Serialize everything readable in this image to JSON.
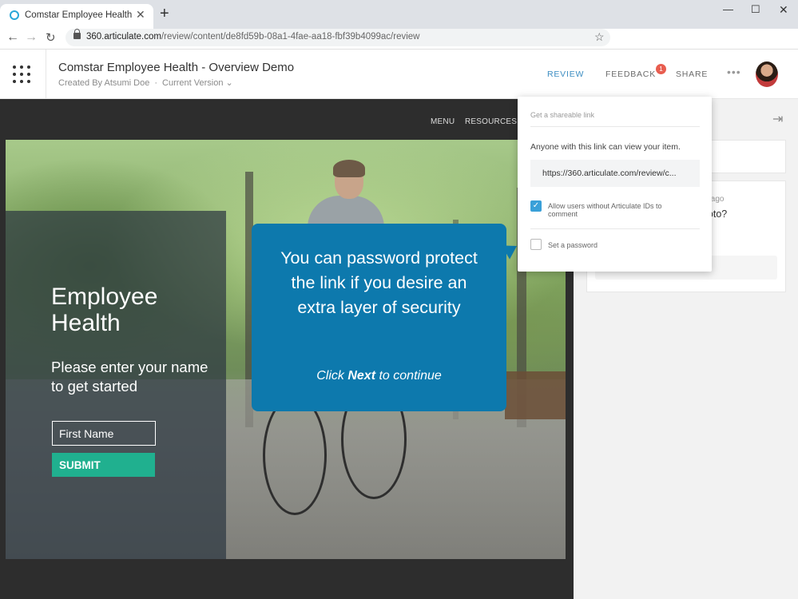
{
  "browser": {
    "tab_title": "Comstar Employee Health - Overview Demo",
    "new_tab_glyph": "+",
    "url_host": "360.articulate.com",
    "url_path": "/review/content/de8fd59b-08a1-4fae-aa18-fbf39b4099ac/review"
  },
  "header": {
    "course_title": "Comstar Employee Health - Overview Demo",
    "created_by": "Created By Atsumi Doe",
    "version": "Current Version",
    "nav": {
      "review": "REVIEW",
      "feedback": "FEEDBACK",
      "share": "SHARE"
    },
    "feedback_badge": "1",
    "accent_color": "#3c8dc2"
  },
  "player": {
    "menu": "MENU",
    "resources": "RESOURCES"
  },
  "slide": {
    "title": "Employee Health",
    "prompt": "Please enter your name to get started",
    "name_placeholder": "First Name",
    "submit": "SUBMIT",
    "submit_color": "#20b08f"
  },
  "callout": {
    "message": "You can password protect the link if you desire an extra layer of security",
    "hint_prefix": "Click ",
    "hint_bold": "Next",
    "hint_suffix": " to continue",
    "color": "#0d79ad"
  },
  "share_popup": {
    "heading": "Get a shareable link",
    "description": "Anyone with this link can view your item.",
    "link_value": "https://360.articulate.com/review/c...",
    "allow_label": "Allow users without Articulate IDs to comment",
    "allow_checked": true,
    "password_label": "Set a password",
    "password_checked": false
  },
  "sidebar": {
    "comment_time_fragment": "s ago",
    "comment_text_fragment": "photo?"
  },
  "icons": [
    "app-grid-icon",
    "lock-icon",
    "star-icon",
    "back-icon",
    "forward-icon",
    "reload-icon",
    "more-icon",
    "collapse-panel-icon",
    "checkmark-icon"
  ]
}
